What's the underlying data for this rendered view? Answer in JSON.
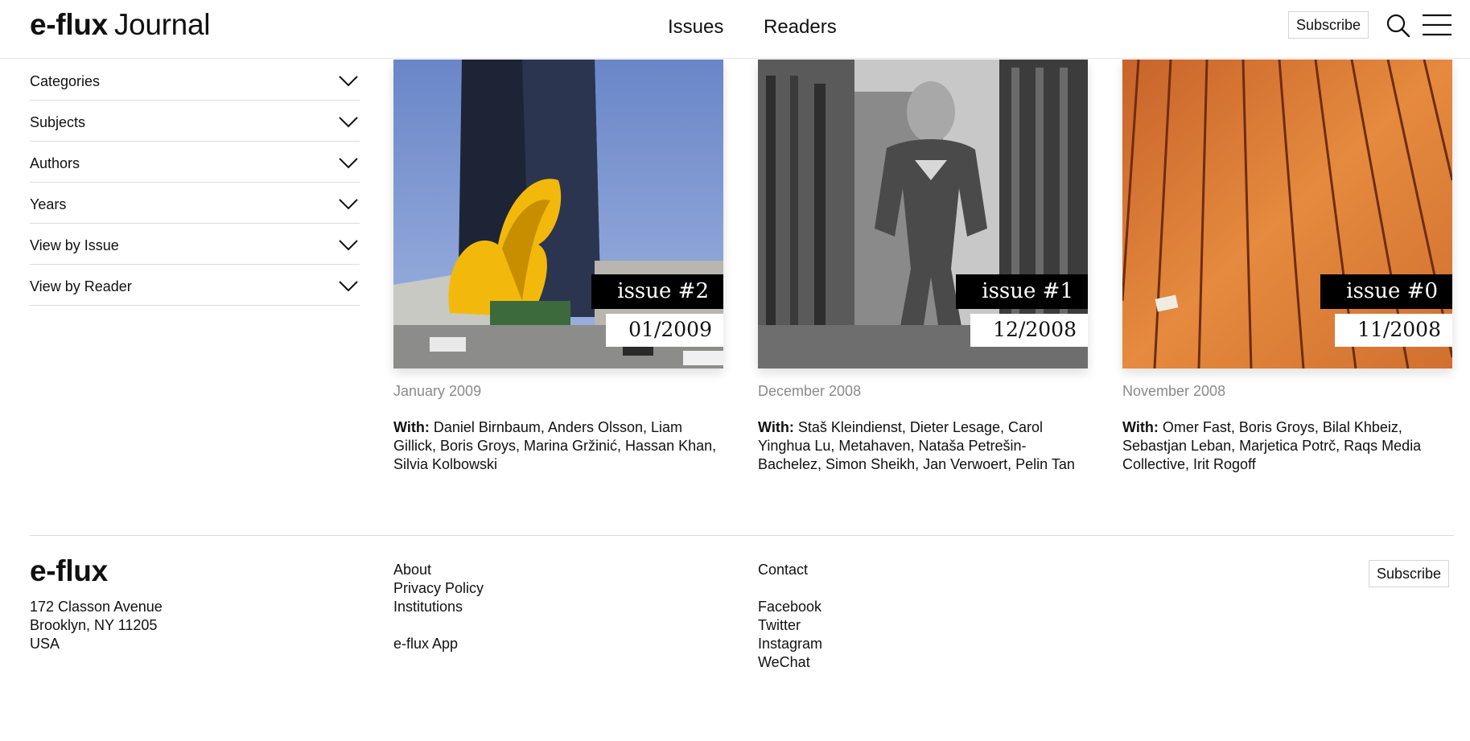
{
  "header": {
    "logo_brand": "e-flux",
    "logo_journal": "Journal",
    "nav": [
      "Issues",
      "Readers"
    ],
    "subscribe_label": "Subscribe",
    "icons": [
      "search-icon",
      "menu-icon"
    ]
  },
  "sidebar": {
    "filters": [
      {
        "label": "Categories"
      },
      {
        "label": "Subjects"
      },
      {
        "label": "Authors"
      },
      {
        "label": "Years"
      },
      {
        "label": "View by Issue"
      },
      {
        "label": "View by Reader"
      }
    ]
  },
  "issues": [
    {
      "tag": "issue #2",
      "tag_date": "01/2009",
      "date": "January 2009",
      "with_label": "With:",
      "contributors": "Daniel Birnbaum, Anders Olsson, Liam Gillick, Boris Groys, Marina Gržinić, Hassan Khan, Silvia Kolbowski"
    },
    {
      "tag": "issue #1",
      "tag_date": "12/2008",
      "date": "December 2008",
      "with_label": "With:",
      "contributors": "Staš Kleindienst, Dieter Lesage, Carol Yinghua Lu, Metahaven, Nataša Petrešin-Bachelez, Simon Sheikh, Jan Verwoert, Pelin Tan"
    },
    {
      "tag": "issue #0",
      "tag_date": "11/2008",
      "date": "November 2008",
      "with_label": "With:",
      "contributors": "Omer Fast, Boris Groys, Bilal Khbeiz, Sebastjan Leban, Marjetica Potrč, Raqs Media Collective, Irit Rogoff"
    }
  ],
  "footer": {
    "logo": "e-flux",
    "address": [
      "172 Classon Avenue",
      "Brooklyn, NY 11205",
      "USA"
    ],
    "links_col1": [
      "About",
      "Privacy Policy",
      "Institutions",
      "e-flux App"
    ],
    "links_col2": [
      "Contact",
      "Facebook",
      "Twitter",
      "Instagram",
      "WeChat"
    ],
    "subscribe_label": "Subscribe"
  },
  "colors": {
    "text": "#111111",
    "muted": "#8a8a8a",
    "divider": "#dcdcdc",
    "tag_bg": "#000000"
  }
}
